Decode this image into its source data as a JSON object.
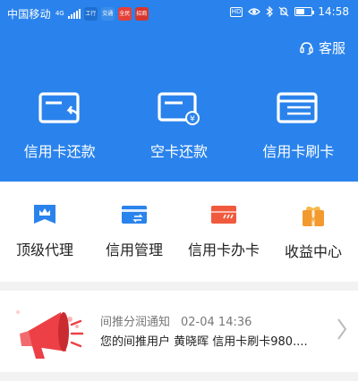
{
  "status_bar": {
    "carrier": "中国移动",
    "network": "4G",
    "app_badges": [
      "工行",
      "交通",
      "全民",
      "招商"
    ],
    "badge_colors": [
      "#1e6fd0",
      "#3b8de8",
      "#e5413a",
      "#d6362e"
    ],
    "time": "14:58",
    "hd_label": "HD",
    "battery_level": 0.55
  },
  "header": {
    "service_label": "客服",
    "service_icon": "headset-icon",
    "background_color": "#2a83ec"
  },
  "hero_actions": [
    {
      "label": "信用卡还款",
      "icon": "card-repay-icon"
    },
    {
      "label": "空卡还款",
      "icon": "empty-card-repay-icon"
    },
    {
      "label": "信用卡刷卡",
      "icon": "card-swipe-icon"
    }
  ],
  "menu": [
    {
      "label": "顶级代理",
      "icon": "crown-icon",
      "color": "#2a83ec"
    },
    {
      "label": "信用管理",
      "icon": "credit-card-icon",
      "color": "#2a83ec"
    },
    {
      "label": "信用卡办卡",
      "icon": "red-card-icon",
      "color": "#f05a3c"
    },
    {
      "label": "收益中心",
      "icon": "gift-box-icon",
      "color": "#f29a2e"
    }
  ],
  "notice": {
    "title": "间推分润通知",
    "time": "02-04 14:36",
    "text": "您的间推用户 黄晓晖 信用卡刷卡980....",
    "icon": "megaphone-icon"
  }
}
